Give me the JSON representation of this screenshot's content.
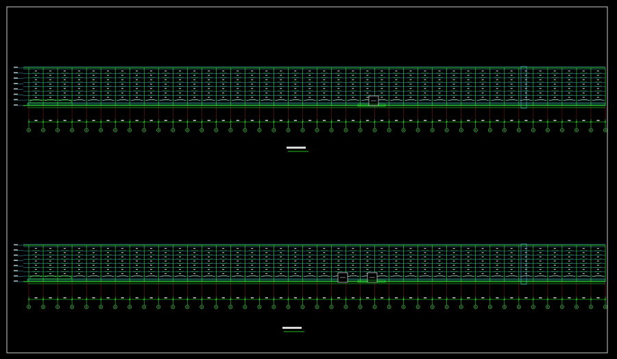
{
  "drawing": {
    "background": "#000000",
    "frame_color": "#ffffff",
    "structure_color": "#33ff33",
    "grid_color": "#5fd7ff",
    "accent_color": "#ff3030",
    "bubble_color": "#33ff33"
  },
  "elevations": [
    {
      "name": "elevation-upper",
      "columns": 40,
      "floor_lines": 8,
      "title": "",
      "scale": ""
    },
    {
      "name": "elevation-lower",
      "columns": 40,
      "floor_lines": 8,
      "title": "",
      "scale": ""
    }
  ]
}
